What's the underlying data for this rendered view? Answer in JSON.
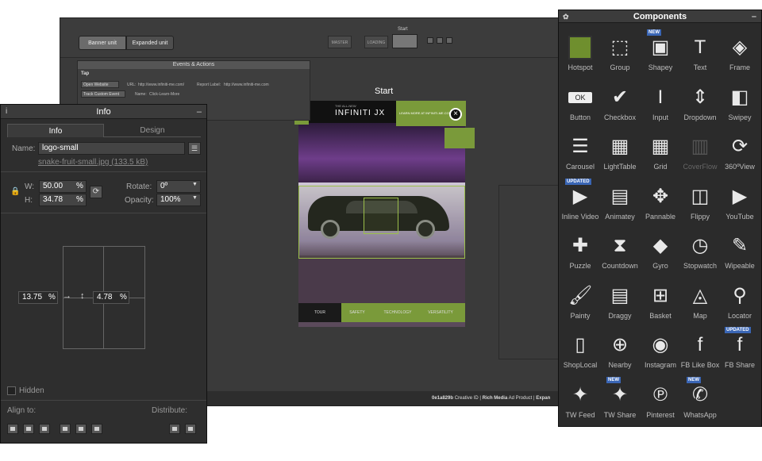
{
  "editor": {
    "unit_tabs": [
      "Banner unit",
      "Expanded unit"
    ],
    "master_label": "MASTER",
    "loading_label": "LOADING",
    "start_top": "Start",
    "start_label": "Start",
    "status": {
      "creative_id": "0e1a829b",
      "creative_id_label": "Creative ID",
      "rich_media": "Rich Media",
      "ad_product": "Ad Product",
      "expand": "Expan"
    }
  },
  "ad": {
    "brand_small": "THE ALL-NEW",
    "brand": "INFINITI JX",
    "learn_more": "LEARN MORE AT INFINITI-ME.COM",
    "nav": [
      "TOUR",
      "SAFETY",
      "TECHNOLOGY",
      "VERSATILITY"
    ]
  },
  "events": {
    "title": "Events & Actions",
    "tap": "Tap",
    "actions": [
      {
        "button": "Open Website",
        "url_label": "URL:",
        "url": "http://www.infiniti-me.com/",
        "report_label": "Report Label:",
        "report": "http://www.infiniti-me.com"
      },
      {
        "button": "Track Custom Event",
        "name_label": "Name:",
        "name": "Click-Learn-More"
      }
    ]
  },
  "info": {
    "title": "Info",
    "tabs": [
      "Info",
      "Design"
    ],
    "name_label": "Name:",
    "name_value": "logo-small",
    "file_link": "snake-fruit-small.jpg (133.5 kB)",
    "w_label": "W:",
    "w_value": "50.00",
    "h_label": "H:",
    "h_value": "34.78",
    "pct": "%",
    "rotate_label": "Rotate:",
    "rotate_value": "0º",
    "opacity_label": "Opacity:",
    "opacity_value": "100%",
    "offset_x": "13.75",
    "offset_y": "4.78",
    "hidden_label": "Hidden",
    "align_label": "Align to:",
    "distribute_label": "Distribute:"
  },
  "components": {
    "title": "Components",
    "items": [
      {
        "name": "Hotspot",
        "icon": "hotspot-icon",
        "glyph": "■"
      },
      {
        "name": "Group",
        "icon": "group-icon",
        "glyph": "⬚"
      },
      {
        "name": "Shapey",
        "icon": "shapey-icon",
        "glyph": "▣",
        "badge": "NEW"
      },
      {
        "name": "Text",
        "icon": "text-icon",
        "glyph": "T"
      },
      {
        "name": "Frame",
        "icon": "frame-icon",
        "glyph": "◈"
      },
      {
        "name": "Button",
        "icon": "button-icon",
        "glyph": "OK"
      },
      {
        "name": "Checkbox",
        "icon": "checkbox-icon",
        "glyph": "✔"
      },
      {
        "name": "Input",
        "icon": "input-icon",
        "glyph": "I"
      },
      {
        "name": "Dropdown",
        "icon": "dropdown-icon",
        "glyph": "⇕"
      },
      {
        "name": "Swipey",
        "icon": "swipey-icon",
        "glyph": "◧"
      },
      {
        "name": "Carousel",
        "icon": "carousel-icon",
        "glyph": "☰"
      },
      {
        "name": "LightTable",
        "icon": "lighttable-icon",
        "glyph": "▦"
      },
      {
        "name": "Grid",
        "icon": "grid-icon",
        "glyph": "▦"
      },
      {
        "name": "CoverFlow",
        "icon": "coverflow-icon",
        "glyph": "▥",
        "disabled": true
      },
      {
        "name": "360ºView",
        "icon": "360-view-icon",
        "glyph": "⟳"
      },
      {
        "name": "Inline Video",
        "icon": "inline-video-icon",
        "glyph": "▶",
        "badge": "UPDATED"
      },
      {
        "name": "Animatey",
        "icon": "animatey-icon",
        "glyph": "▤"
      },
      {
        "name": "Pannable",
        "icon": "pannable-icon",
        "glyph": "✥"
      },
      {
        "name": "Flippy",
        "icon": "flippy-icon",
        "glyph": "◫"
      },
      {
        "name": "YouTube",
        "icon": "youtube-icon",
        "glyph": "▶"
      },
      {
        "name": "Puzzle",
        "icon": "puzzle-icon",
        "glyph": "✚"
      },
      {
        "name": "Countdown",
        "icon": "countdown-icon",
        "glyph": "⧗"
      },
      {
        "name": "Gyro",
        "icon": "gyro-icon",
        "glyph": "◆"
      },
      {
        "name": "Stopwatch",
        "icon": "stopwatch-icon",
        "glyph": "◷"
      },
      {
        "name": "Wipeable",
        "icon": "wipeable-icon",
        "glyph": "✎"
      },
      {
        "name": "Painty",
        "icon": "painty-icon",
        "glyph": "🖌"
      },
      {
        "name": "Draggy",
        "icon": "draggy-icon",
        "glyph": "▤"
      },
      {
        "name": "Basket",
        "icon": "basket-icon",
        "glyph": "⊞"
      },
      {
        "name": "Map",
        "icon": "map-icon",
        "glyph": "◬"
      },
      {
        "name": "Locator",
        "icon": "locator-icon",
        "glyph": "⚲"
      },
      {
        "name": "ShopLocal",
        "icon": "shoplocal-icon",
        "glyph": "▯"
      },
      {
        "name": "Nearby",
        "icon": "nearby-icon",
        "glyph": "⊕"
      },
      {
        "name": "Instagram",
        "icon": "instagram-icon",
        "glyph": "◉"
      },
      {
        "name": "FB Like Box",
        "icon": "fb-like-box-icon",
        "glyph": "f"
      },
      {
        "name": "FB Share",
        "icon": "fb-share-icon",
        "glyph": "f",
        "badge": "UPDATED"
      },
      {
        "name": "TW Feed",
        "icon": "tw-feed-icon",
        "glyph": "✦"
      },
      {
        "name": "TW Share",
        "icon": "tw-share-icon",
        "glyph": "✦",
        "badge": "NEW"
      },
      {
        "name": "Pinterest",
        "icon": "pinterest-icon",
        "glyph": "℗"
      },
      {
        "name": "WhatsApp",
        "icon": "whatsapp-icon",
        "glyph": "✆",
        "badge": "NEW"
      }
    ]
  },
  "colors": {
    "accent_green": "#7a9a3a",
    "badge_blue": "#3a66b5",
    "panel_bg": "#2b2b2b"
  }
}
